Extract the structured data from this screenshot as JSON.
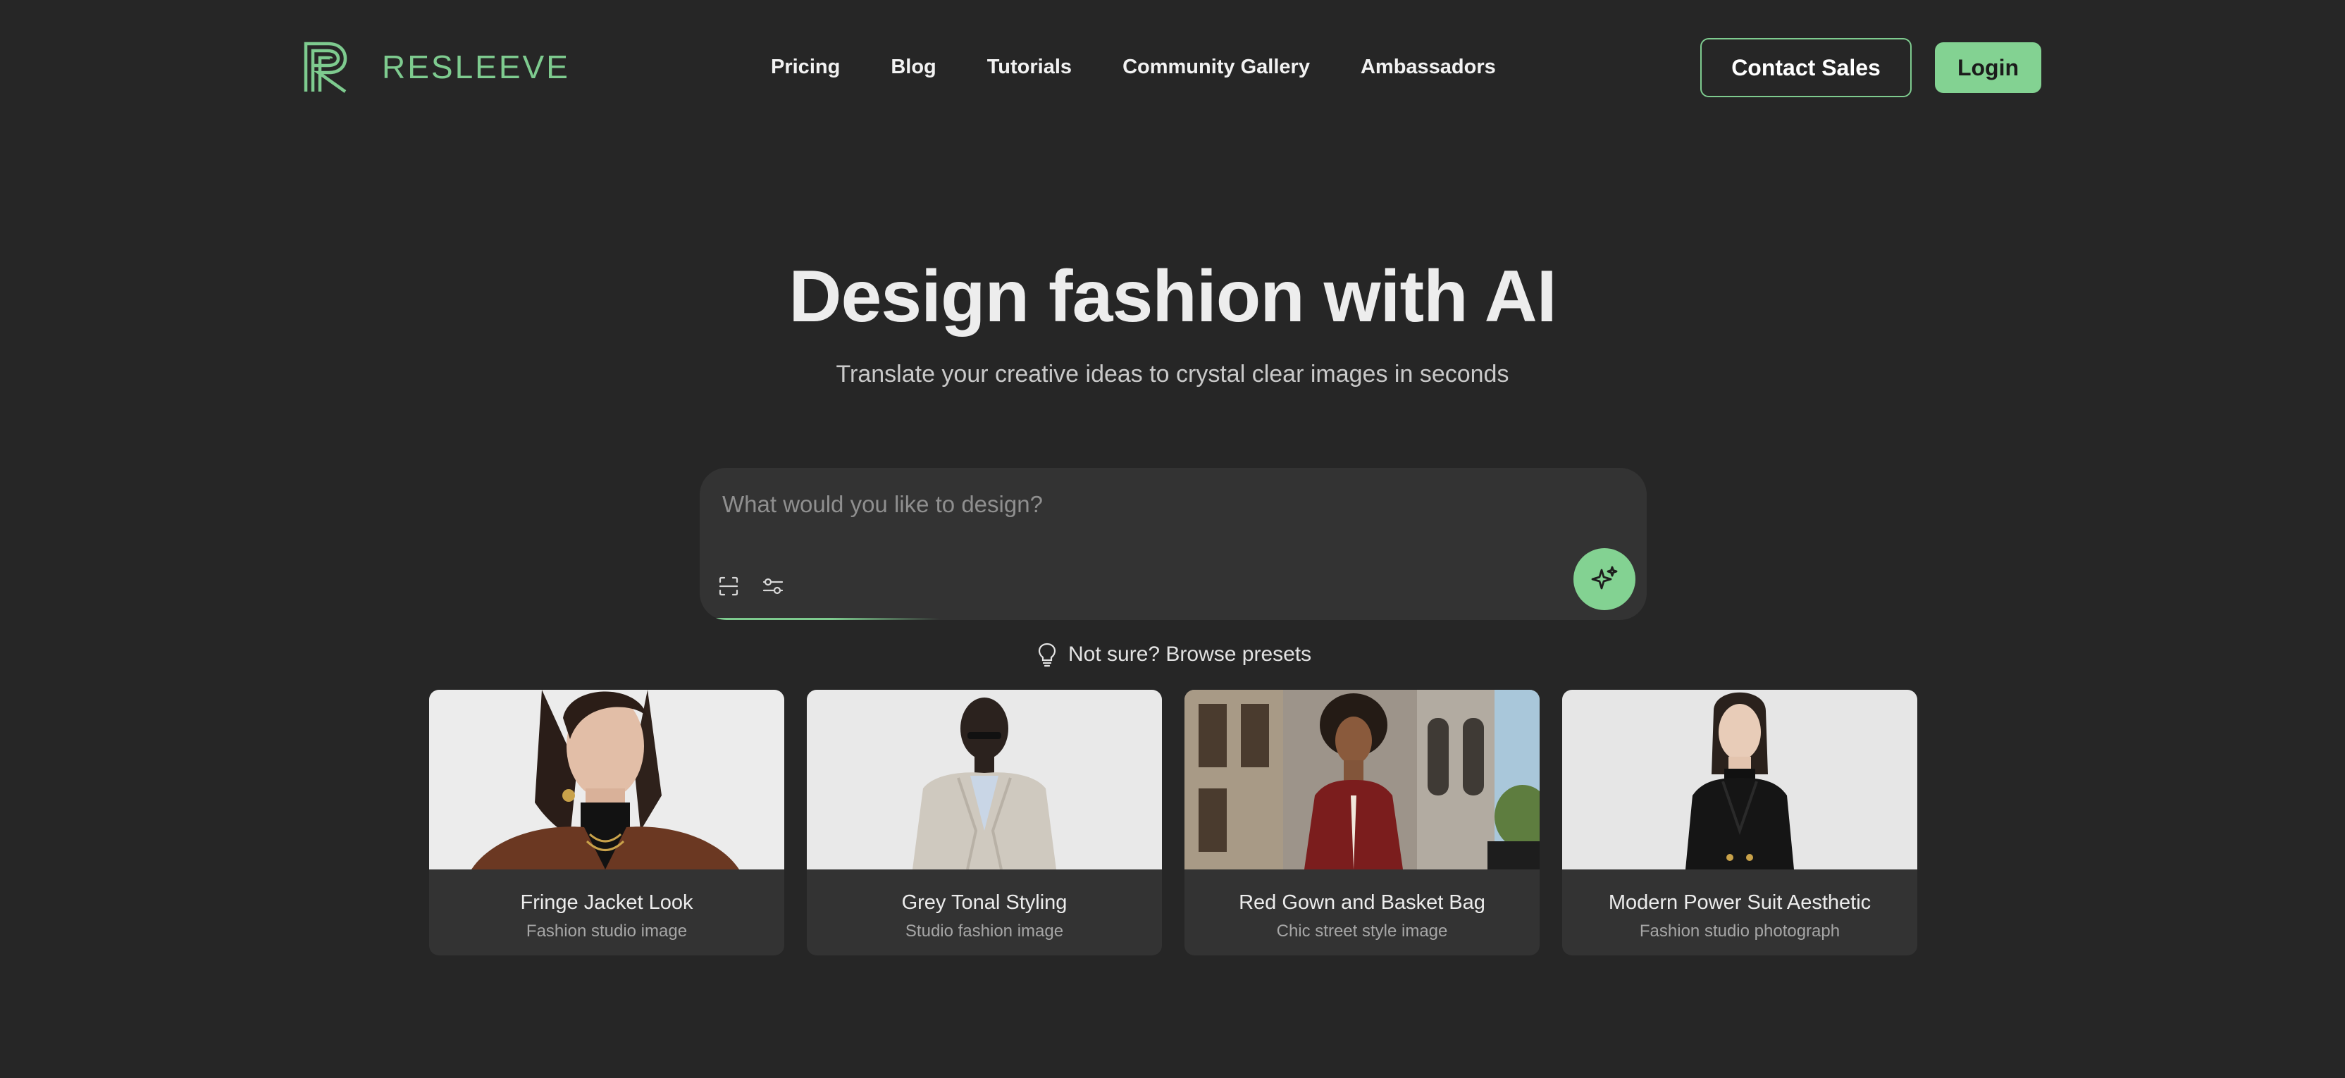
{
  "brand": {
    "name": "RESLEEVE",
    "accent": "#7ecb8f",
    "button_green": "#83d292",
    "background": "#262626"
  },
  "nav": {
    "items": [
      {
        "label": "Pricing"
      },
      {
        "label": "Blog"
      },
      {
        "label": "Tutorials"
      },
      {
        "label": "Community Gallery"
      },
      {
        "label": "Ambassadors"
      }
    ],
    "contact_label": "Contact Sales",
    "login_label": "Login"
  },
  "hero": {
    "title": "Design fashion with AI",
    "subtitle": "Translate your creative ideas to crystal clear images in seconds"
  },
  "prompt": {
    "placeholder": "What would you like to design?",
    "value": "",
    "tools": [
      "scan-icon",
      "sliders-icon"
    ],
    "generate_icon": "sparkles-icon"
  },
  "presets": {
    "link_label": "Not sure? Browse presets",
    "icon": "lightbulb-icon",
    "cards": [
      {
        "title": "Fringe Jacket Look",
        "subtitle": "Fashion studio image"
      },
      {
        "title": "Grey Tonal Styling",
        "subtitle": "Studio fashion image"
      },
      {
        "title": "Red Gown and Basket Bag",
        "subtitle": "Chic street style image"
      },
      {
        "title": "Modern Power Suit Aesthetic",
        "subtitle": "Fashion studio photograph"
      }
    ]
  }
}
